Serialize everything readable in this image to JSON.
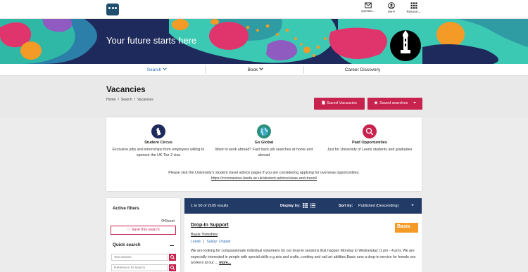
{
  "topbar": {
    "items": [
      {
        "label": "Questio...",
        "icon": "envelope-icon"
      },
      {
        "label": "Me ▾",
        "icon": "user-icon"
      },
      {
        "label": "Resourc...",
        "icon": "grid-icon"
      }
    ]
  },
  "hero": {
    "title": "Your future starts here"
  },
  "subnav": {
    "items": [
      {
        "label": "Search",
        "active": true
      },
      {
        "label": "Book"
      },
      {
        "label": "Career Discovery"
      }
    ]
  },
  "page": {
    "title": "Vacancies",
    "breadcrumb": [
      "Home",
      "/",
      "Search",
      "/",
      "Vacancies"
    ],
    "saved_vacancies_label": "Saved Vacancies",
    "saved_searches_label": "Saved searches"
  },
  "promo": {
    "columns": [
      {
        "title": "Student Circus",
        "desc": "Exclusive jobs and internships from employers willing to sponsor the UK Tier 2 visa",
        "icon": "uk-map-icon"
      },
      {
        "title": "Go Global",
        "desc": "Want to work abroad? Fast track job searches at home and abroad",
        "icon": "globe-icon"
      },
      {
        "title": "Paid Opportunities",
        "desc": "Just for University of Leeds students and graduates",
        "icon": "money-search-icon"
      }
    ],
    "note": "Please visit the University's student travel advice pages if you are considering applying for overseas opportunities.",
    "link": "https://coronavirus.leeds.ac.uk/student-advice/visas-and-travel/"
  },
  "filters": {
    "title": "Active filters",
    "reset_label": "Reset",
    "save_search_label": "Save this search",
    "quick_search_title": "Quick search",
    "text_search_placeholder": "Text search",
    "reference_placeholder": "Reference ID search"
  },
  "results": {
    "count_text": "1 to 50 of 2105 results",
    "display_label": "Display by:",
    "sort_label": "Sort by:",
    "sort_value": "Published (Descending)"
  },
  "job": {
    "title": "Drop-In Support",
    "org": "Basis Yorkshire",
    "location": "Leeds",
    "separator": "|",
    "salary": "Salary: Unpaid",
    "description": "We are looking for compassionate individual volunteers for our drop-in sessions that happen Monday to Wednesday (1 pm - 4 pm). We are especially interested in people with special skills e.g arts and crafts, cooking and nail art abilities.Basis runs a drop-in service for female sex workers at our ...",
    "more_label": "more...",
    "logo_text": "Basis"
  },
  "colors": {
    "brand_navy": "#1f2a5c",
    "accent_pink": "#c8234f",
    "results_bar": "#213a66",
    "hero_teal": "#3cc9b4",
    "hero_orange": "#f39a27",
    "hero_magenta": "#e0356c"
  }
}
